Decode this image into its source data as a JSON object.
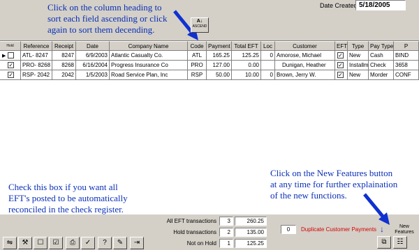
{
  "header": {
    "callout_sort_line1": "Click on the column heading to",
    "callout_sort_line2": "sort each field ascending or click",
    "callout_sort_line3": "again to sort them decending.",
    "date_created_label": "Date Created",
    "date_created_value": "5/18/2005",
    "sort_button_label": "ASCEND"
  },
  "grid": {
    "columns": [
      "Hold",
      "Reference",
      "Receipt",
      "Date",
      "Company Name",
      "Code",
      "Payment",
      "Total EFT",
      "Loc",
      "Customer",
      "EFT",
      "Type",
      "Pay Type",
      "P"
    ],
    "rows": [
      {
        "pointer": "▶",
        "hold": false,
        "reference": "ATL- 8247",
        "receipt": "8247",
        "date": "6/9/2003",
        "company": "Atlantic Casualty Co.",
        "code": "ATL",
        "payment": "165.25",
        "total_eft": "125.25",
        "loc": "0",
        "customer": "Amorose, Michael",
        "eft": true,
        "type": "New",
        "pay_type": "Cash",
        "p": "BIND"
      },
      {
        "pointer": "",
        "hold": true,
        "reference": "PRO- 8268",
        "receipt": "8268",
        "date": "6/16/2004",
        "company": "Progress Insurance Co",
        "code": "PRO",
        "payment": "127.00",
        "total_eft": "0.00",
        "loc": "",
        "customer": "Dunigan, Heather",
        "eft": true,
        "type": "Installme",
        "pay_type": "Check",
        "p": "3658"
      },
      {
        "pointer": "",
        "hold": true,
        "reference": "RSP- 2042",
        "receipt": "2042",
        "date": "1/5/2003",
        "company": "Road Service Plan, Inc",
        "code": "RSP",
        "payment": "50.00",
        "total_eft": "10.00",
        "loc": "0",
        "customer": "Brown, Jerry W.",
        "eft": true,
        "type": "New",
        "pay_type": "Morder",
        "p": "CONF"
      }
    ]
  },
  "callouts": {
    "hold_line1": "Check this box if you want all",
    "hold_line2": "EFT's posted to be automatically",
    "hold_line3": "reconciled in the check register.",
    "new_features_line1": "Click on the New Features button",
    "new_features_line2": "at any time for further explaination",
    "new_features_line3": "of the new functions."
  },
  "totals": {
    "all_eft_label": "All EFT transactions",
    "all_eft_count": "3",
    "all_eft_amount": "260.25",
    "hold_label": "Hold  transactions",
    "hold_count": "2",
    "hold_amount": "135.00",
    "not_on_hold_label": "Not on Hold",
    "not_on_hold_count": "1",
    "not_on_hold_amount": "125.25"
  },
  "duplicate": {
    "count": "0",
    "label": "Duplicate Customer Payments"
  },
  "new_features": {
    "label_line1": "New",
    "label_line2": "Features"
  },
  "colors": {
    "callout_blue": "#0a2fb5",
    "duplicate_red": "#d40000",
    "window_gray": "#d4d0c8"
  }
}
